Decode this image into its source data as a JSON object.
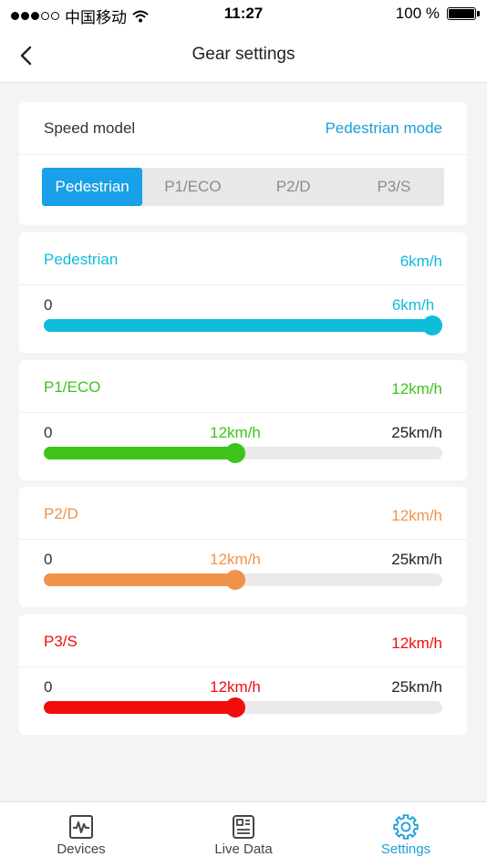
{
  "status_bar": {
    "carrier": "中国移动",
    "time": "11:27",
    "battery": "100 %",
    "battery_level": 1.0,
    "signal_bars": 3
  },
  "nav": {
    "title": "Gear settings"
  },
  "speed_model": {
    "label": "Speed model",
    "value": "Pedestrian mode",
    "segments": [
      "Pedestrian",
      "P1/ECO",
      "P2/D",
      "P3/S"
    ],
    "active_index": 0
  },
  "gears": [
    {
      "name": "Pedestrian",
      "speed": "6km/h",
      "min": "0",
      "current": "6km/h",
      "max": "",
      "value": 6,
      "max_value": 6,
      "color": "#0fbcdb"
    },
    {
      "name": "P1/ECO",
      "speed": "12km/h",
      "min": "0",
      "current": "12km/h",
      "max": "25km/h",
      "value": 12,
      "max_value": 25,
      "color": "#3dc41b"
    },
    {
      "name": "P2/D",
      "speed": "12km/h",
      "min": "0",
      "current": "12km/h",
      "max": "25km/h",
      "value": 12,
      "max_value": 25,
      "color": "#f0934a"
    },
    {
      "name": "P3/S",
      "speed": "12km/h",
      "min": "0",
      "current": "12km/h",
      "max": "25km/h",
      "value": 12,
      "max_value": 25,
      "color": "#f20c0c"
    }
  ],
  "tabs": [
    {
      "label": "Devices",
      "icon": "pulse-monitor-icon"
    },
    {
      "label": "Live Data",
      "icon": "live-data-icon"
    },
    {
      "label": "Settings",
      "icon": "gear-icon"
    }
  ],
  "active_tab": 2,
  "colors": {
    "accent": "#1c9ed9",
    "segment_active": "#18a0e8"
  }
}
